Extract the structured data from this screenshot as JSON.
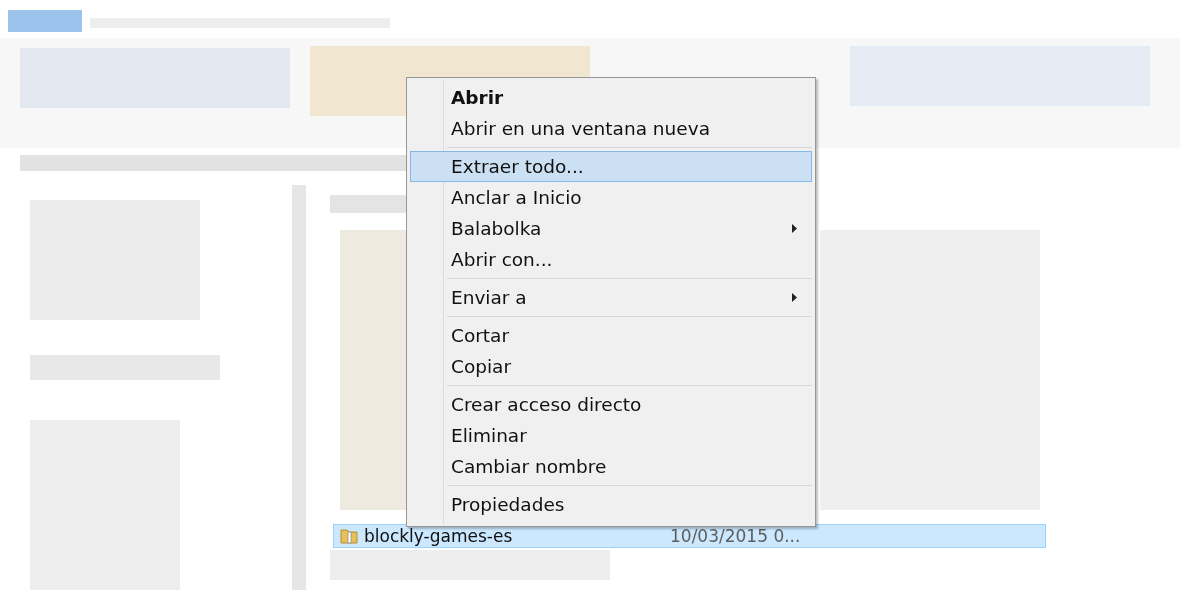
{
  "file_row": {
    "name": "blockly-games-es",
    "date": "10/03/2015 0...",
    "selected": true
  },
  "context_menu": {
    "items": [
      {
        "kind": "item",
        "label": "Abrir",
        "default": true,
        "selected": false,
        "submenu": false
      },
      {
        "kind": "item",
        "label": "Abrir en una ventana nueva",
        "default": false,
        "selected": false,
        "submenu": false
      },
      {
        "kind": "separator"
      },
      {
        "kind": "item",
        "label": "Extraer todo...",
        "default": false,
        "selected": true,
        "submenu": false
      },
      {
        "kind": "item",
        "label": "Anclar a Inicio",
        "default": false,
        "selected": false,
        "submenu": false
      },
      {
        "kind": "item",
        "label": "Balabolka",
        "default": false,
        "selected": false,
        "submenu": true
      },
      {
        "kind": "item",
        "label": "Abrir con...",
        "default": false,
        "selected": false,
        "submenu": false
      },
      {
        "kind": "separator"
      },
      {
        "kind": "item",
        "label": "Enviar a",
        "default": false,
        "selected": false,
        "submenu": true
      },
      {
        "kind": "separator"
      },
      {
        "kind": "item",
        "label": "Cortar",
        "default": false,
        "selected": false,
        "submenu": false
      },
      {
        "kind": "item",
        "label": "Copiar",
        "default": false,
        "selected": false,
        "submenu": false
      },
      {
        "kind": "separator"
      },
      {
        "kind": "item",
        "label": "Crear acceso directo",
        "default": false,
        "selected": false,
        "submenu": false
      },
      {
        "kind": "item",
        "label": "Eliminar",
        "default": false,
        "selected": false,
        "submenu": false
      },
      {
        "kind": "item",
        "label": "Cambiar nombre",
        "default": false,
        "selected": false,
        "submenu": false
      },
      {
        "kind": "separator"
      },
      {
        "kind": "item",
        "label": "Propiedades",
        "default": false,
        "selected": false,
        "submenu": false
      }
    ]
  }
}
